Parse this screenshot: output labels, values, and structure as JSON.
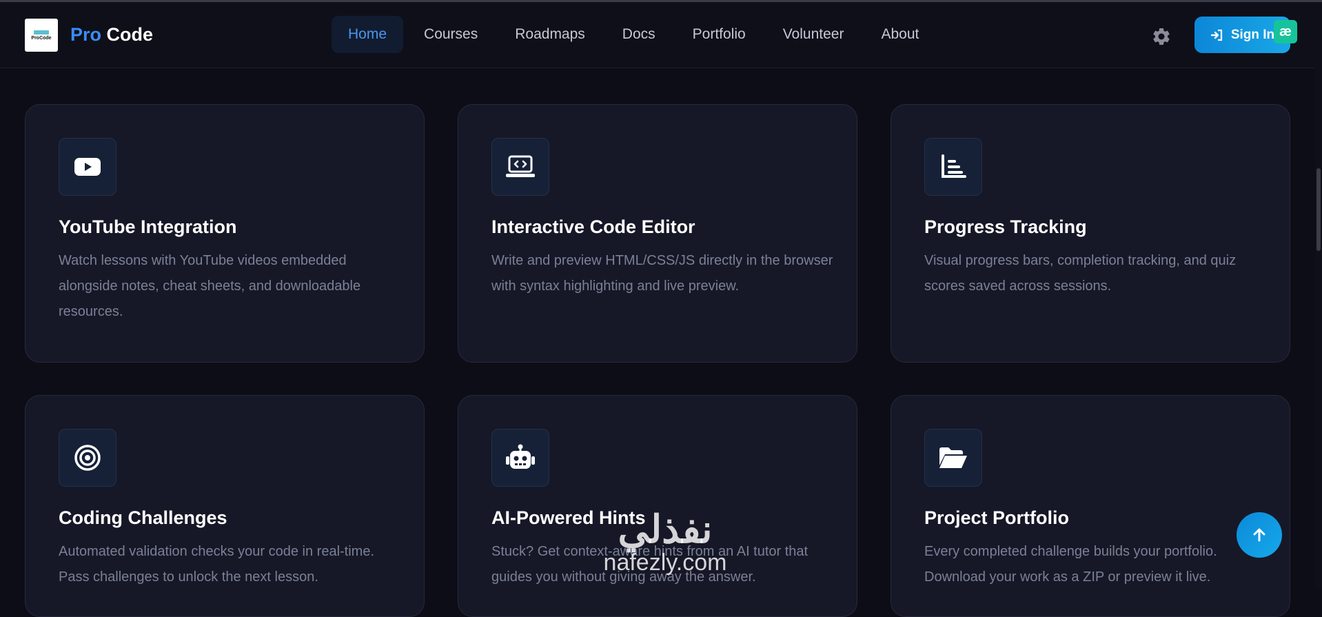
{
  "header": {
    "logo_text": "ProCode",
    "brand_first": "Pro",
    "brand_second": "Code",
    "nav": [
      {
        "label": "Home",
        "active": true
      },
      {
        "label": "Courses"
      },
      {
        "label": "Roadmaps"
      },
      {
        "label": "Docs"
      },
      {
        "label": "Portfolio"
      },
      {
        "label": "Volunteer"
      },
      {
        "label": "About"
      }
    ],
    "theme_icon": "gear-icon",
    "signin_label": "Sign In",
    "extension_badge": "æ"
  },
  "features": [
    {
      "icon": "youtube-icon",
      "title": "YouTube Integration",
      "description": "Watch lessons with YouTube videos embedded alongside notes, cheat sheets, and downloadable resources."
    },
    {
      "icon": "laptop-code-icon",
      "title": "Interactive Code Editor",
      "description": "Write and preview HTML/CSS/JS directly in the browser with syntax highlighting and live preview."
    },
    {
      "icon": "bar-chart-icon",
      "title": "Progress Tracking",
      "description": "Visual progress bars, completion tracking, and quiz scores saved across sessions."
    },
    {
      "icon": "target-icon",
      "title": "Coding Challenges",
      "description": "Automated validation checks your code in real-time. Pass challenges to unlock the next lesson."
    },
    {
      "icon": "robot-icon",
      "title": "AI-Powered Hints",
      "description": "Stuck? Get context-aware hints from an AI tutor that guides you without giving away the answer."
    },
    {
      "icon": "folder-open-icon",
      "title": "Project Portfolio",
      "description": "Every completed challenge builds your portfolio. Download your work as a ZIP or preview it live."
    }
  ],
  "watermark": {
    "arabic": "نفذلي",
    "latin": "nafezly.com"
  },
  "colors": {
    "accent": "#3b8cf5",
    "background": "#0c0d17",
    "card": "#161827",
    "button": "#0c87d8"
  }
}
